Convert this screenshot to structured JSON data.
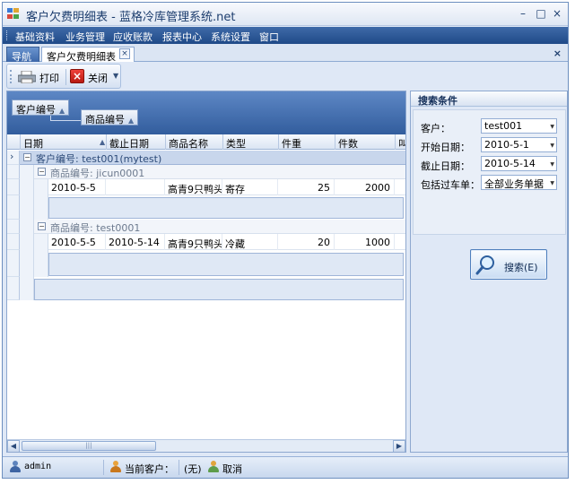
{
  "window": {
    "title": "客户欠费明细表 - 蓝格冷库管理系统.net"
  },
  "window_controls": {
    "minimize": "–",
    "maximize": "□",
    "close": "×"
  },
  "menu": {
    "items": [
      "基础资料",
      "业务管理",
      "应收账款",
      "报表中心",
      "系统设置",
      "窗口"
    ]
  },
  "tabs": {
    "nav": "导航",
    "active": "客户欠费明细表",
    "tab_close": "×",
    "strip_close": "×"
  },
  "toolbar": {
    "print_label": "打印",
    "close_label": "关闭",
    "dropdown": "▼"
  },
  "grid": {
    "group_chips": [
      {
        "label": "客户编号",
        "arrow": "▲"
      },
      {
        "label": "商品编号",
        "arrow": "▲"
      }
    ],
    "columns": [
      "日期",
      "截止日期",
      "商品名称",
      "类型",
      "件重",
      "件数",
      "叫"
    ],
    "sort_arrow": "▲",
    "row_indicator": "›",
    "expander": "−",
    "customer_group": "客户编号: test001(mytest)",
    "product_groups": [
      {
        "label": "商品编号: jicun0001",
        "rows": [
          [
            "2010-5-5",
            "",
            "高青9只鸭头",
            "寄存",
            "25",
            "2000"
          ]
        ]
      },
      {
        "label": "商品编号: test0001",
        "rows": [
          [
            "2010-5-5",
            "2010-5-14",
            "高青9只鸭头",
            "冷藏",
            "20",
            "1000"
          ]
        ]
      }
    ],
    "scroll_left": "◀",
    "scroll_right": "▶",
    "thumb_grip": "|||"
  },
  "search": {
    "title": "搜索条件",
    "fields": [
      {
        "label": "客户：",
        "value": "test001"
      },
      {
        "label": "开始日期：",
        "value": "2010-5-1"
      },
      {
        "label": "截止日期：",
        "value": "2010-5-14"
      },
      {
        "label": "包括过车单：",
        "value": "全部业务单据"
      }
    ],
    "dropdown_arrow": "▼",
    "button_label": "搜索(E)"
  },
  "status": {
    "user": "admin",
    "current_customer_label": "当前客户：",
    "current_customer_value": "(无)",
    "cancel": "取消"
  },
  "colors": {
    "accent": "#1f4a88",
    "group_header": "#c8d6ec",
    "panel": "#dfe8f6"
  },
  "icons": {
    "app": "app-icon",
    "print": "printer-icon",
    "close": "close-x-icon",
    "search": "magnifier-icon",
    "user": "user-icon",
    "customer": "customer-icon",
    "cancel": "cancel-icon"
  }
}
